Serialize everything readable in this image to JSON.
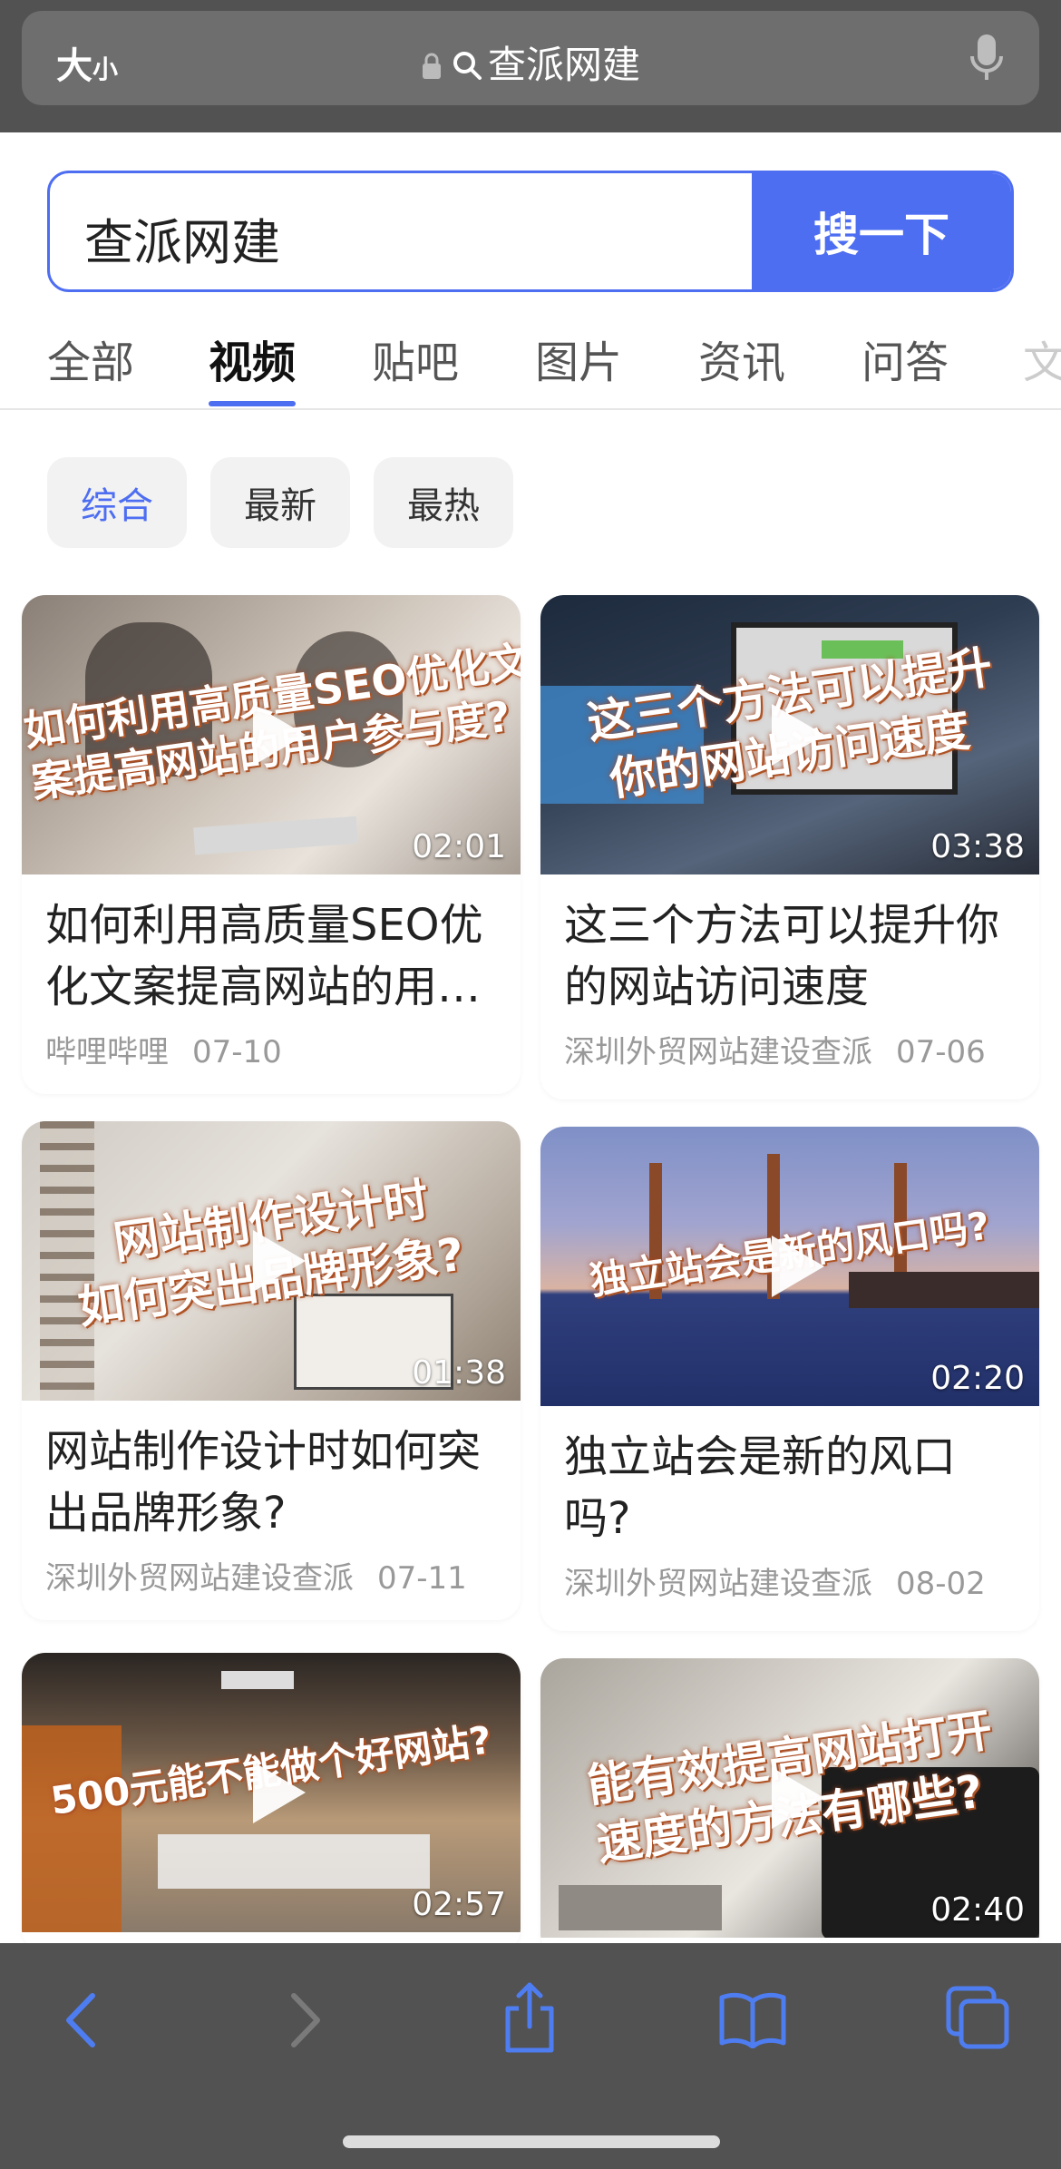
{
  "browser": {
    "text_size_big": "大",
    "text_size_small": "小",
    "address": "查派网建"
  },
  "search": {
    "query": "查派网建",
    "button": "搜一下"
  },
  "tabs": [
    "全部",
    "视频",
    "贴吧",
    "图片",
    "资讯",
    "问答",
    "文"
  ],
  "active_tab": "视频",
  "filters": [
    "综合",
    "最新",
    "最热"
  ],
  "active_filter": "综合",
  "videos": [
    {
      "overlay_line1": "如何利用高质量SEO优化文",
      "overlay_line2": "案提高网站的用户参与度?",
      "duration": "02:01",
      "title": "如何利用高质量SEO优化文案提高网站的用户参与度?",
      "source": "哔哩哔哩",
      "date": "07-10"
    },
    {
      "overlay_line1": "这三个方法可以提升",
      "overlay_line2": "你的网站访问速度",
      "duration": "03:38",
      "title": "这三个方法可以提升你的网站访问速度",
      "source": "深圳外贸网站建设查派",
      "date": "07-06"
    },
    {
      "overlay_line1": "网站制作设计时",
      "overlay_line2": "如何突出品牌形象?",
      "duration": "01:38",
      "title": "网站制作设计时如何突出品牌形象?",
      "source": "深圳外贸网站建设查派",
      "date": "07-11"
    },
    {
      "overlay_line1": "独立站会是新的风口吗?",
      "overlay_line2": "",
      "duration": "02:20",
      "title": "独立站会是新的风口吗?",
      "source": "深圳外贸网站建设查派",
      "date": "08-02"
    },
    {
      "overlay_line1": "500元能不能做个好网站?",
      "overlay_line2": "",
      "duration": "02:57",
      "title": "",
      "source": "",
      "date": ""
    },
    {
      "overlay_line1": "能有效提高网站打开",
      "overlay_line2": "速度的方法有哪些?",
      "duration": "02:40",
      "title": "",
      "source": "",
      "date": ""
    }
  ],
  "colors": {
    "accent": "#4e6ef2",
    "browser_chrome": "#525252",
    "toolbar_icon": "#4e7df2"
  }
}
